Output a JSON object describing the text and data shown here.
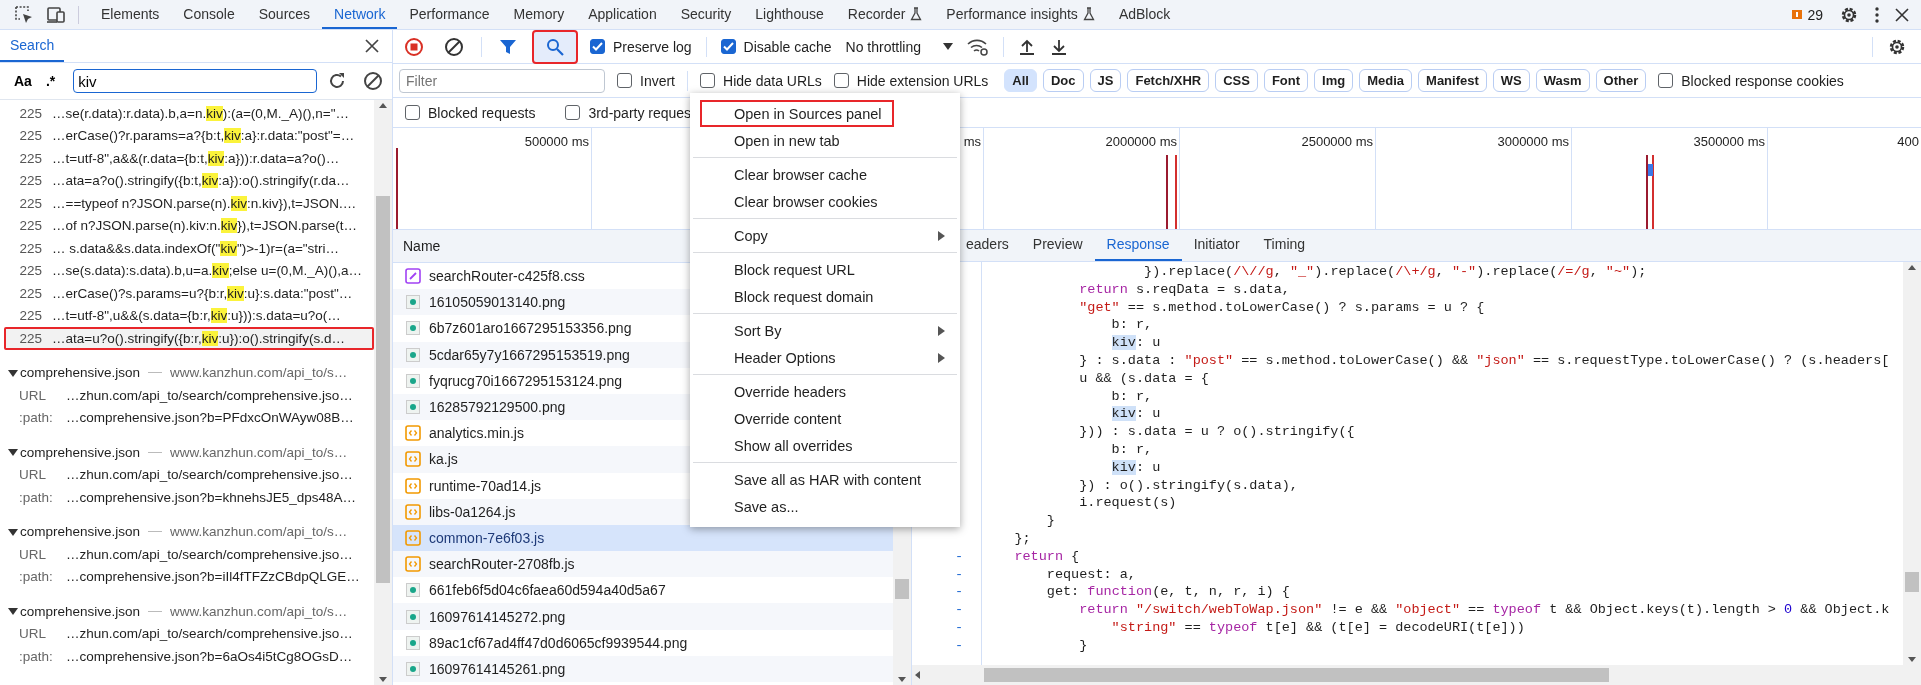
{
  "devtools_tabs": [
    {
      "label": "Elements",
      "selected": false,
      "kind": "plain"
    },
    {
      "label": "Console",
      "selected": false,
      "kind": "plain"
    },
    {
      "label": "Sources",
      "selected": false,
      "kind": "plain"
    },
    {
      "label": "Network",
      "selected": true,
      "kind": "plain"
    },
    {
      "label": "Performance",
      "selected": false,
      "kind": "plain"
    },
    {
      "label": "Memory",
      "selected": false,
      "kind": "plain"
    },
    {
      "label": "Application",
      "selected": false,
      "kind": "plain"
    },
    {
      "label": "Security",
      "selected": false,
      "kind": "plain"
    },
    {
      "label": "Lighthouse",
      "selected": false,
      "kind": "plain"
    },
    {
      "label": "Recorder",
      "selected": false,
      "kind": "experimental"
    },
    {
      "label": "Performance insights",
      "selected": false,
      "kind": "experimental"
    },
    {
      "label": "AdBlock",
      "selected": false,
      "kind": "plain"
    }
  ],
  "issues_count": "29",
  "search_panel": {
    "title": "Search",
    "case_toggle": "Aa",
    "regex_toggle": ".*",
    "query": "kiv",
    "results": [
      {
        "line": "225",
        "before": "…se(r.data):r.data).b,a=n.",
        "match": "kiv",
        "after": "):(a=(0,M._A)(),n=\"…",
        "highlighted": false
      },
      {
        "line": "225",
        "before": "…erCase()?r.params=a?{b:t,",
        "match": "kiv",
        "after": ":a}:r.data:\"post\"=…",
        "highlighted": false
      },
      {
        "line": "225",
        "before": "…t=utf-8\",a&&(r.data={b:t,",
        "match": "kiv",
        "after": ":a})):r.data=a?o()…",
        "highlighted": false
      },
      {
        "line": "225",
        "before": "…ata=a?o().stringify({b:t,",
        "match": "kiv",
        "after": ":a}):o().stringify(r.da…",
        "highlighted": false
      },
      {
        "line": "225",
        "before": "…==typeof n?JSON.parse(n).",
        "match": "kiv",
        "after": ":n.kiv}),t=JSON.…",
        "highlighted": false
      },
      {
        "line": "225",
        "before": "…of n?JSON.parse(n).kiv:n.",
        "match": "kiv",
        "after": "}),t=JSON.parse(t…",
        "highlighted": false
      },
      {
        "line": "225",
        "before": "… s.data&&s.data.indexOf(\"",
        "match": "kiv",
        "after": "\")>-1)r=(a=\"stri…",
        "highlighted": false
      },
      {
        "line": "225",
        "before": "…se(s.data):s.data).b,u=a.",
        "match": "kiv",
        "after": ";else u=(0,M._A)(),a…",
        "highlighted": false
      },
      {
        "line": "225",
        "before": "…erCase()?s.params=u?{b:r,",
        "match": "kiv",
        "after": ":u}:s.data:\"post\"…",
        "highlighted": false
      },
      {
        "line": "225",
        "before": "…t=utf-8\",u&&(s.data={b:r,",
        "match": "kiv",
        "after": ":u})):s.data=u?o(…",
        "highlighted": false
      },
      {
        "line": "225",
        "before": "…ata=u?o().stringify({b:r,",
        "match": "kiv",
        "after": ":u}):o().stringify(s.d…",
        "highlighted": true
      }
    ],
    "files": [
      {
        "name": "comprehensive.json",
        "url": "www.kanzhun.com/api_to/s…",
        "rows": [
          {
            "label": "URL",
            "value": "…zhun.com/api_to/search/comprehensive.jso…"
          },
          {
            "label": ":path:",
            "value": "…comprehensive.json?b=PFdxcOnWAyw08B…"
          }
        ]
      },
      {
        "name": "comprehensive.json",
        "url": "www.kanzhun.com/api_to/s…",
        "rows": [
          {
            "label": "URL",
            "value": "…zhun.com/api_to/search/comprehensive.jso…"
          },
          {
            "label": ":path:",
            "value": "…comprehensive.json?b=khnehsJE5_dps48A…"
          }
        ]
      },
      {
        "name": "comprehensive.json",
        "url": "www.kanzhun.com/api_to/s…",
        "rows": [
          {
            "label": "URL",
            "value": "…zhun.com/api_to/search/comprehensive.jso…"
          },
          {
            "label": ":path:",
            "value": "…comprehensive.json?b=iIl4fTFZzCBdpQLGE…"
          }
        ]
      },
      {
        "name": "comprehensive.json",
        "url": "www.kanzhun.com/api_to/s…",
        "rows": [
          {
            "label": "URL",
            "value": "…zhun.com/api_to/search/comprehensive.jso…"
          },
          {
            "label": ":path:",
            "value": "…comprehensive.json?b=6aOs4i5tCg8OGsD…"
          }
        ]
      }
    ]
  },
  "network": {
    "toolbar": {
      "search_selected": true,
      "search_highlighted": true,
      "toggles": [
        {
          "label": "Preserve log",
          "checked": true
        },
        {
          "label": "Disable cache",
          "checked": true
        }
      ],
      "throttling": "No throttling"
    },
    "filter": {
      "placeholder": "Filter",
      "checkboxes": [
        {
          "label": "Invert",
          "checked": false
        },
        {
          "label": "Hide data URLs",
          "checked": false
        },
        {
          "label": "Hide extension URLs",
          "checked": false
        }
      ],
      "types": [
        {
          "label": "All",
          "selected": true
        },
        {
          "label": "Doc",
          "selected": false
        },
        {
          "label": "JS",
          "selected": false
        },
        {
          "label": "Fetch/XHR",
          "selected": false
        },
        {
          "label": "CSS",
          "selected": false
        },
        {
          "label": "Font",
          "selected": false
        },
        {
          "label": "Img",
          "selected": false
        },
        {
          "label": "Media",
          "selected": false
        },
        {
          "label": "Manifest",
          "selected": false
        },
        {
          "label": "WS",
          "selected": false
        },
        {
          "label": "Wasm",
          "selected": false
        },
        {
          "label": "Other",
          "selected": false
        }
      ],
      "end_checkbox": {
        "label": "Blocked response cookies",
        "checked": false
      },
      "second_row": [
        {
          "label": "Blocked requests",
          "checked": false
        },
        {
          "label": "3rd-party reques",
          "checked": false
        }
      ]
    },
    "overview": {
      "ticks": [
        {
          "label": "500000 ms",
          "kind": "single"
        },
        {
          "label": "ms",
          "kind": "double"
        },
        {
          "label": "2000000 ms",
          "kind": "single"
        },
        {
          "label": "2500000 ms",
          "kind": "single"
        },
        {
          "label": "3000000 ms",
          "kind": "single"
        },
        {
          "label": "3500000 ms",
          "kind": "single"
        },
        {
          "label": "400",
          "kind": "last"
        }
      ]
    },
    "requests": {
      "column": "Name",
      "rows": [
        {
          "name": "searchRouter-c425f8.css",
          "kind": "css",
          "selected": false
        },
        {
          "name": "16105059013140.png",
          "kind": "image",
          "selected": false
        },
        {
          "name": "6b7z601aro1667295153356.png",
          "kind": "image",
          "selected": false
        },
        {
          "name": "5cdar65y7y1667295153519.png",
          "kind": "image",
          "selected": false
        },
        {
          "name": "fyqrucg70i1667295153124.png",
          "kind": "image",
          "selected": false
        },
        {
          "name": "16285792129500.png",
          "kind": "image",
          "selected": false
        },
        {
          "name": "analytics.min.js",
          "kind": "js",
          "selected": false
        },
        {
          "name": "ka.js",
          "kind": "js",
          "selected": false
        },
        {
          "name": "runtime-70ad14.js",
          "kind": "js",
          "selected": false
        },
        {
          "name": "libs-0a1264.js",
          "kind": "js",
          "selected": false
        },
        {
          "name": "common-7e6f03.js",
          "kind": "js",
          "selected": true
        },
        {
          "name": "searchRouter-2708fb.js",
          "kind": "js",
          "selected": false
        },
        {
          "name": "661feb6f5d04c6faea60d594a40d5a67",
          "kind": "image",
          "selected": false
        },
        {
          "name": "16097614145272.png",
          "kind": "image",
          "selected": false
        },
        {
          "name": "89ac1cf67ad4ff47d0d6065cf9939544.png",
          "kind": "image",
          "selected": false
        },
        {
          "name": "16097614145261.png",
          "kind": "image",
          "selected": false
        }
      ]
    },
    "details": {
      "tabs": [
        {
          "label": "eaders",
          "selected": false
        },
        {
          "label": "Preview",
          "selected": false
        },
        {
          "label": "Response",
          "selected": true
        },
        {
          "label": "Initiator",
          "selected": false
        },
        {
          "label": "Timing",
          "selected": false
        }
      ],
      "code": [
        {
          "tokens": [
            {
              "text": "                    }).replace(",
              "kind": "plain"
            },
            {
              "text": "/\\//g",
              "kind": "str"
            },
            {
              "text": ", ",
              "kind": "plain"
            },
            {
              "text": "\"_\"",
              "kind": "str"
            },
            {
              "text": ").replace(",
              "kind": "plain"
            },
            {
              "text": "/\\+/g",
              "kind": "str"
            },
            {
              "text": ", ",
              "kind": "plain"
            },
            {
              "text": "\"-\"",
              "kind": "str"
            },
            {
              "text": ").replace(",
              "kind": "plain"
            },
            {
              "text": "/=/g",
              "kind": "str"
            },
            {
              "text": ", ",
              "kind": "plain"
            },
            {
              "text": "\"~\"",
              "kind": "str"
            },
            {
              "text": ");",
              "kind": "plain"
            }
          ]
        },
        {
          "tokens": [
            {
              "text": "            return",
              "kind": "kw"
            },
            {
              "text": " s.reqData = s.data,",
              "kind": "plain"
            }
          ]
        },
        {
          "tokens": [
            {
              "text": "            \"get\"",
              "kind": "str"
            },
            {
              "text": " == s.method.toLowerCase() ? s.params = u ? {",
              "kind": "plain"
            }
          ]
        },
        {
          "tokens": [
            {
              "text": "                b: r,",
              "kind": "plain"
            }
          ]
        },
        {
          "tokens": [
            {
              "text": "                kiv",
              "kind": "match"
            },
            {
              "text": ": u",
              "kind": "plain"
            }
          ]
        },
        {
          "tokens": [
            {
              "text": "            } : s.data : ",
              "kind": "plain"
            },
            {
              "text": "\"post\"",
              "kind": "str"
            },
            {
              "text": " == s.method.toLowerCase() && ",
              "kind": "plain"
            },
            {
              "text": "\"json\"",
              "kind": "str"
            },
            {
              "text": " == s.requestType.toLowerCase() ? (s.headers[",
              "kind": "plain"
            }
          ]
        },
        {
          "tokens": [
            {
              "text": "            u && (s.data = {",
              "kind": "plain"
            }
          ]
        },
        {
          "tokens": [
            {
              "text": "                b: r,",
              "kind": "plain"
            }
          ]
        },
        {
          "tokens": [
            {
              "text": "                kiv",
              "kind": "match"
            },
            {
              "text": ": u",
              "kind": "plain"
            }
          ]
        },
        {
          "tokens": [
            {
              "text": "            })) : s.data = u ? o().stringify({",
              "kind": "plain"
            }
          ]
        },
        {
          "tokens": [
            {
              "text": "                b: r,",
              "kind": "plain"
            }
          ]
        },
        {
          "tokens": [
            {
              "text": "                kiv",
              "kind": "match"
            },
            {
              "text": ": u",
              "kind": "plain"
            }
          ]
        },
        {
          "tokens": [
            {
              "text": "            }) : o().stringify(s.data),",
              "kind": "plain"
            }
          ]
        },
        {
          "tokens": [
            {
              "text": "            i.request(s)",
              "kind": "plain"
            }
          ]
        },
        {
          "tokens": [
            {
              "text": "        }",
              "kind": "plain"
            }
          ]
        },
        {
          "tokens": [
            {
              "text": "    };",
              "kind": "plain"
            }
          ]
        },
        {
          "gutter": "-",
          "tokens": [
            {
              "text": "    return",
              "kind": "kw"
            },
            {
              "text": " {",
              "kind": "plain"
            }
          ]
        },
        {
          "gutter": "-",
          "tokens": [
            {
              "text": "        request: a,",
              "kind": "plain"
            }
          ]
        },
        {
          "gutter": "-",
          "tokens": [
            {
              "text": "        get: ",
              "kind": "plain"
            },
            {
              "text": "function",
              "kind": "kw"
            },
            {
              "text": "(e, t, n, r, i) {",
              "kind": "plain"
            }
          ]
        },
        {
          "gutter": "-",
          "tokens": [
            {
              "text": "            return ",
              "kind": "kw"
            },
            {
              "text": "\"/switch/webToWap.json\"",
              "kind": "str"
            },
            {
              "text": " != e && ",
              "kind": "plain"
            },
            {
              "text": "\"object\"",
              "kind": "str"
            },
            {
              "text": " == ",
              "kind": "plain"
            },
            {
              "text": "typeof",
              "kind": "kw"
            },
            {
              "text": " t && Object.keys(t).length > ",
              "kind": "plain"
            },
            {
              "text": "0",
              "kind": "num"
            },
            {
              "text": " && Object.k",
              "kind": "plain"
            }
          ]
        },
        {
          "gutter": "-",
          "tokens": [
            {
              "text": "                \"string\"",
              "kind": "str"
            },
            {
              "text": " == ",
              "kind": "plain"
            },
            {
              "text": "typeof",
              "kind": "kw"
            },
            {
              "text": " t[e] && (t[e] = decodeURI(t[e]))",
              "kind": "plain"
            }
          ]
        },
        {
          "gutter": "-",
          "tokens": [
            {
              "text": "            }",
              "kind": "plain"
            }
          ]
        }
      ]
    }
  },
  "context_menu": {
    "groups": [
      {
        "items": [
          {
            "label": "Open in Sources panel",
            "submenu": false,
            "highlighted": true
          },
          {
            "label": "Open in new tab",
            "submenu": false,
            "highlighted": false
          }
        ]
      },
      {
        "items": [
          {
            "label": "Clear browser cache",
            "submenu": false,
            "highlighted": false
          },
          {
            "label": "Clear browser cookies",
            "submenu": false,
            "highlighted": false
          }
        ]
      },
      {
        "items": [
          {
            "label": "Copy",
            "submenu": true,
            "highlighted": false
          }
        ]
      },
      {
        "items": [
          {
            "label": "Block request URL",
            "submenu": false,
            "highlighted": false
          },
          {
            "label": "Block request domain",
            "submenu": false,
            "highlighted": false
          }
        ]
      },
      {
        "items": [
          {
            "label": "Sort By",
            "submenu": true,
            "highlighted": false
          },
          {
            "label": "Header Options",
            "submenu": true,
            "highlighted": false
          }
        ]
      },
      {
        "items": [
          {
            "label": "Override headers",
            "submenu": false,
            "highlighted": false
          },
          {
            "label": "Override content",
            "submenu": false,
            "highlighted": false
          },
          {
            "label": "Show all overrides",
            "submenu": false,
            "highlighted": false
          }
        ]
      },
      {
        "items": [
          {
            "label": "Save all as HAR with content",
            "submenu": false,
            "highlighted": false
          },
          {
            "label": "Save as...",
            "submenu": false,
            "highlighted": false
          }
        ]
      }
    ]
  }
}
